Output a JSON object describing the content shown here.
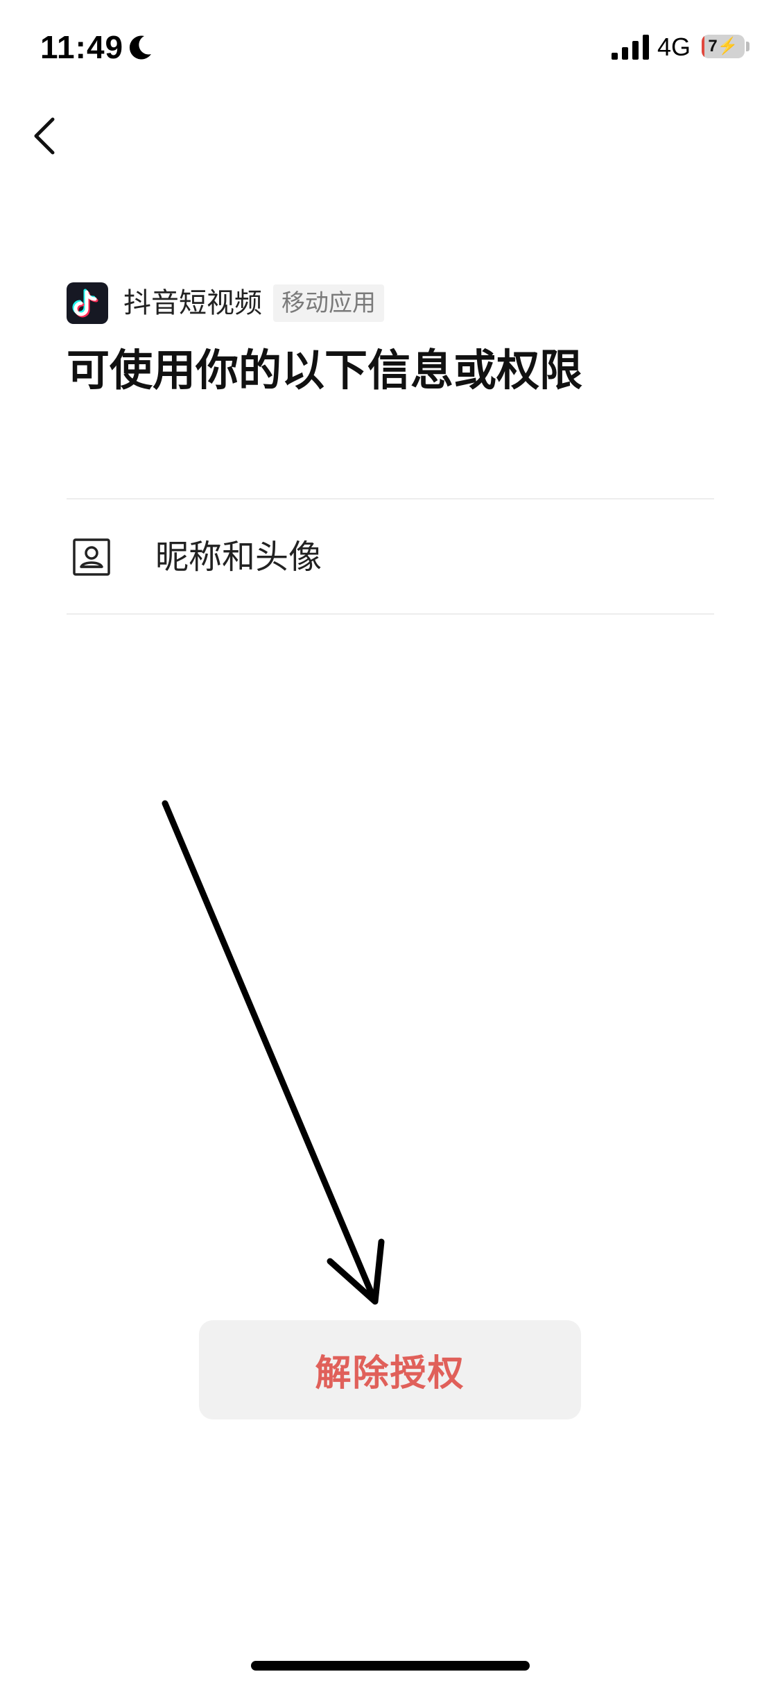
{
  "status_bar": {
    "time": "11:49",
    "network": "4G",
    "battery_level": "7",
    "battery_fraction": 0.07,
    "icons": [
      "moon-icon",
      "signal-icon",
      "battery-icon"
    ]
  },
  "nav": {
    "back_icon": "chevron-left-icon"
  },
  "app": {
    "name": "抖音短视频",
    "tag": "移动应用",
    "logo_icon": "douyin-logo-icon"
  },
  "page_title": "可使用你的以下信息或权限",
  "permissions": [
    {
      "label": "昵称和头像",
      "icon": "profile-card-icon"
    }
  ],
  "actions": {
    "revoke_label": "解除授权"
  },
  "colors": {
    "revoke_text": "#e0605a",
    "revoke_bg": "#f1f1f1",
    "divider": "#ededed",
    "battery_low": "#e0483d"
  }
}
